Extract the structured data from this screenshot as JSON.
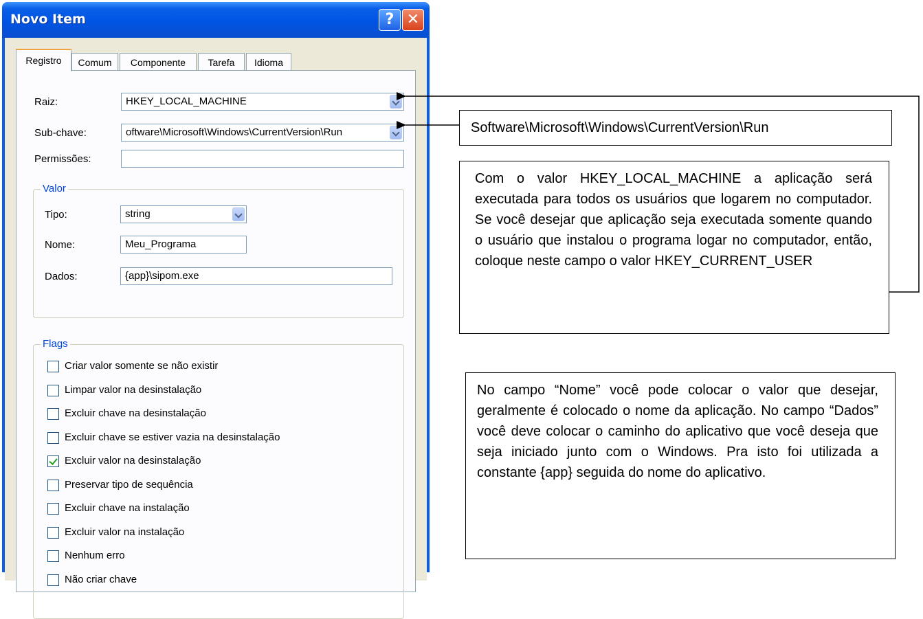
{
  "dialog": {
    "title": "Novo Item",
    "help_label": "?",
    "close_label": "✕",
    "tabs": [
      "Registro",
      "Comum",
      "Componente",
      "Tarefa",
      "Idioma"
    ],
    "active_tab": "Registro"
  },
  "registro": {
    "raiz_label": "Raiz:",
    "raiz_value": "HKEY_LOCAL_MACHINE",
    "subchave_label": "Sub-chave:",
    "subchave_value": "oftware\\Microsoft\\Windows\\CurrentVersion\\Run",
    "permissoes_label": "Permissões:",
    "permissoes_value": "",
    "valor": {
      "title": "Valor",
      "tipo_label": "Tipo:",
      "tipo_value": "string",
      "nome_label": "Nome:",
      "nome_value": "Meu_Programa",
      "dados_label": "Dados:",
      "dados_value": "{app}\\sipom.exe"
    },
    "flags": {
      "title": "Flags",
      "items": [
        {
          "label": "Criar valor somente se não existir",
          "checked": false
        },
        {
          "label": "Limpar valor na desinstalação",
          "checked": false
        },
        {
          "label": "Excluir chave na desinstalação",
          "checked": false
        },
        {
          "label": "Excluir chave se estiver vazia na desinstalação",
          "checked": false
        },
        {
          "label": "Excluir valor na desinstalação",
          "checked": true
        },
        {
          "label": "Preservar tipo de sequência",
          "checked": false
        },
        {
          "label": "Excluir chave na instalação",
          "checked": false
        },
        {
          "label": "Excluir valor na instalação",
          "checked": false
        },
        {
          "label": "Nenhum erro",
          "checked": false
        },
        {
          "label": "Não criar chave",
          "checked": false
        }
      ]
    }
  },
  "annotations": {
    "subchave_text": "Software\\Microsoft\\Windows\\CurrentVersion\\Run",
    "raiz_text": "Com o valor HKEY_LOCAL_MACHINE a aplicação será executada para todos os usuários que logarem no computador. Se você desejar que aplicação seja executada somente quando o usuário que instalou o programa logar no computador, então, coloque neste campo o valor HKEY_CURRENT_USER",
    "nome_text": "No campo “Nome” você pode colocar o valor que desejar, geralmente é colocado o nome da aplicação. No campo “Dados” você deve colocar o caminho do aplicativo que você deseja que seja iniciado junto com o Windows. Pra isto foi utilizada a constante {app} seguida do nome do aplicativo."
  }
}
